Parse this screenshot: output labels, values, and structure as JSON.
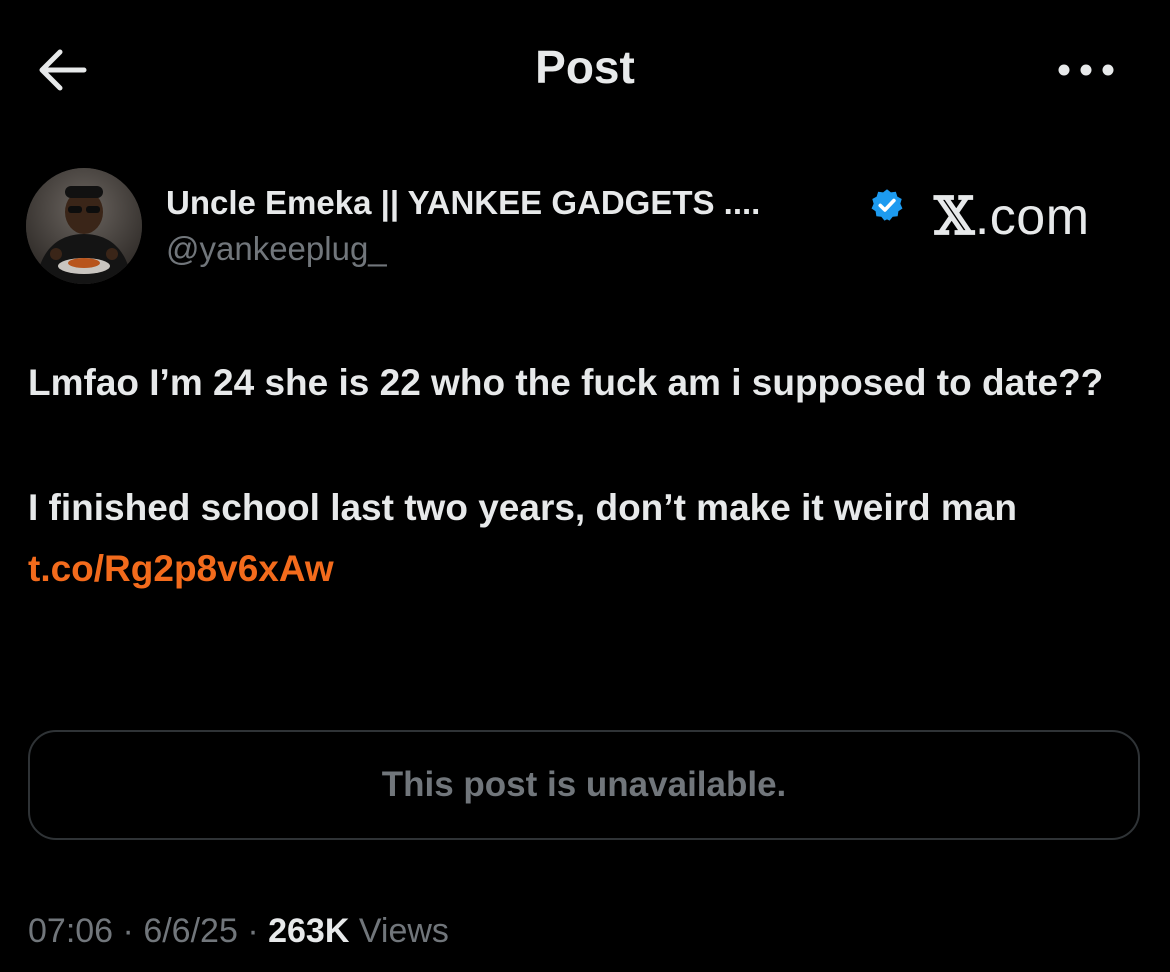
{
  "header": {
    "title": "Post",
    "back_icon": "arrow-left-icon",
    "more_icon": "more-horizontal-icon"
  },
  "author": {
    "display_name": "Uncle Emeka || YANKEE GADGETS ....",
    "handle": "@yankeeplug_",
    "verified_color": "#1d9bf0"
  },
  "watermark": {
    "x": "𝕏",
    "suffix": ".com"
  },
  "post": {
    "line1": "Lmfao I’m 24 she is 22 who the fuck am i supposed to date??",
    "line2_text": "I finished school last two years, don’t make it weird man ",
    "link": "t.co/Rg2p8v6xAw",
    "link_color": "#f36b1c"
  },
  "quote": {
    "text": "This post is unavailable."
  },
  "meta": {
    "time": "07:06",
    "date": "6/6/25",
    "separator": "·",
    "views_count": "263K",
    "views_label": "Views"
  }
}
